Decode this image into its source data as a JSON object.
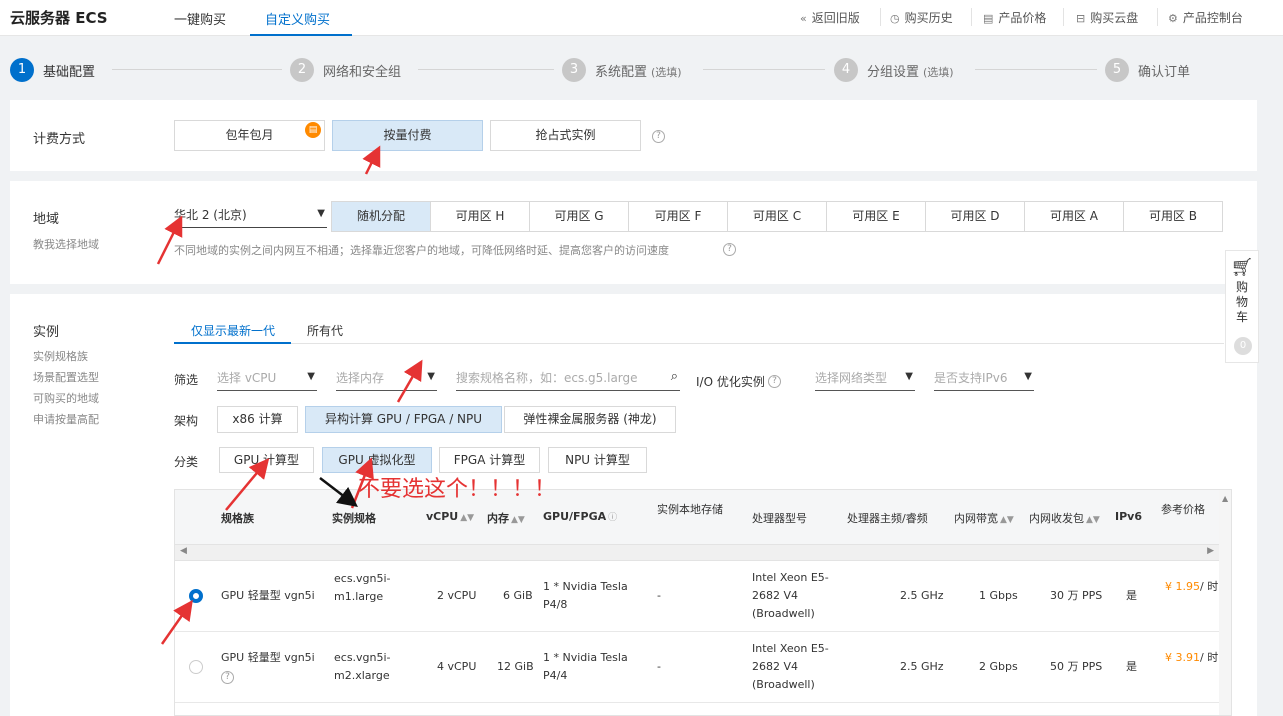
{
  "header": {
    "logo": "云服务器 ECS",
    "tabs": [
      "一键购买",
      "自定义购买"
    ],
    "links": [
      "返回旧版",
      "购买历史",
      "产品价格",
      "购买云盘",
      "产品控制台"
    ]
  },
  "steps": [
    {
      "num": "1",
      "label": "基础配置",
      "optional": ""
    },
    {
      "num": "2",
      "label": "网络和安全组",
      "optional": ""
    },
    {
      "num": "3",
      "label": "系统配置",
      "optional": "(选填)"
    },
    {
      "num": "4",
      "label": "分组设置",
      "optional": "(选填)"
    },
    {
      "num": "5",
      "label": "确认订单",
      "optional": ""
    }
  ],
  "billing": {
    "label": "计费方式",
    "options": [
      "包年包月",
      "按量付费",
      "抢占式实例"
    ]
  },
  "region": {
    "label": "地域",
    "sub": "教我选择地域",
    "selected": "华北 2 (北京)",
    "zones": [
      "随机分配",
      "可用区 H",
      "可用区 G",
      "可用区 F",
      "可用区 C",
      "可用区 E",
      "可用区 D",
      "可用区 A",
      "可用区 B"
    ],
    "hint": "不同地域的实例之间内网互不相通；选择靠近您客户的地域，可降低网络时延、提高您客户的访问速度"
  },
  "instance": {
    "label": "实例",
    "side_links": [
      "实例规格族",
      "场景配置选型",
      "可购买的地域",
      "申请按量高配"
    ],
    "subtabs": [
      "仅显示最新一代",
      "所有代"
    ],
    "filter_label": "筛选",
    "filters": {
      "vcpu": "选择 vCPU",
      "memory": "选择内存",
      "search_placeholder": "搜索规格名称，如：ecs.g5.large",
      "io_label": "I/O 优化实例",
      "network": "选择网络类型",
      "ipv6": "是否支持IPv6"
    },
    "arch_label": "架构",
    "arch_options": [
      "x86 计算",
      "异构计算 GPU / FPGA / NPU",
      "弹性裸金属服务器 (神龙)"
    ],
    "category_label": "分类",
    "category_options": [
      "GPU 计算型",
      "GPU 虚拟化型",
      "FPGA 计算型",
      "NPU 计算型"
    ]
  },
  "table": {
    "columns": [
      "规格族",
      "实例规格",
      "vCPU",
      "内存",
      "GPU/FPGA",
      "实例本地存储",
      "处理器型号",
      "处理器主频/睿频",
      "内网带宽",
      "内网收发包",
      "IPv6",
      "参考价格"
    ],
    "rows": [
      {
        "family": "GPU 轻量型 vgn5i",
        "spec": "ecs.vgn5i-m1.large",
        "vcpu": "2 vCPU",
        "mem": "6 GiB",
        "gpu": "1 * Nvidia Tesla P4/8",
        "storage": "-",
        "cpu": "Intel Xeon E5-2682 V4 (Broadwell)",
        "freq": "2.5 GHz",
        "bw": "1 Gbps",
        "pps": "30 万 PPS",
        "ipv6": "是",
        "price": "¥ 1.95",
        "unit": "/ 时",
        "selected": true
      },
      {
        "family": "GPU 轻量型 vgn5i",
        "spec": "ecs.vgn5i-m2.xlarge",
        "vcpu": "4 vCPU",
        "mem": "12 GiB",
        "gpu": "1 * Nvidia Tesla P4/4",
        "storage": "-",
        "cpu": "Intel Xeon E5-2682 V4 (Broadwell)",
        "freq": "2.5 GHz",
        "bw": "2 Gbps",
        "pps": "50 万 PPS",
        "ipv6": "是",
        "price": "¥ 3.91",
        "unit": "/ 时",
        "selected": false
      }
    ]
  },
  "cart": {
    "label": "购物车",
    "count": "0"
  },
  "annotation": "不要选这个！！！！",
  "colors": {
    "accent": "#0070cc",
    "selected_bg": "#d9e9f7",
    "annotation": "#e53333",
    "price": "#ff8a00"
  }
}
